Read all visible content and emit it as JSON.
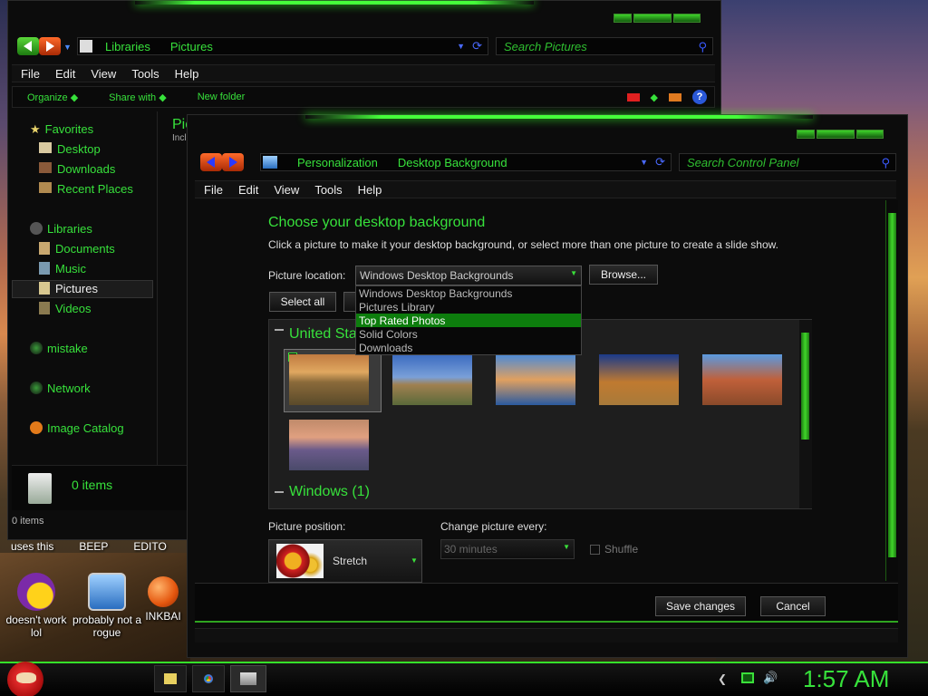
{
  "desktop": {
    "icons": [
      {
        "label": "doesn't work lol",
        "icon": "yahoo-messenger-icon"
      },
      {
        "label": "probably not a rogue",
        "icon": "gears-monitor-icon"
      },
      {
        "label": "INKBAI",
        "icon": "orange-ball-icon"
      }
    ],
    "partial_labels": [
      "uses this",
      "BEEP",
      "EDITO"
    ]
  },
  "explorer": {
    "address": [
      "Libraries",
      "Pictures"
    ],
    "search_placeholder": "Search Pictures",
    "menu": [
      "File",
      "Edit",
      "View",
      "Tools",
      "Help"
    ],
    "toolbar": {
      "organize": "Organize",
      "share": "Share with",
      "new_folder": "New folder"
    },
    "nav": {
      "favorites": "Favorites",
      "favorites_items": [
        "Desktop",
        "Downloads",
        "Recent Places"
      ],
      "libraries": "Libraries",
      "library_items": [
        "Documents",
        "Music",
        "Pictures",
        "Videos"
      ],
      "mistake": "mistake",
      "network": "Network",
      "image_catalog": "Image Catalog"
    },
    "content_title_partial": "Pic",
    "content_sub_partial": "Incl",
    "details_count": "0 items",
    "status": "0 items"
  },
  "personalization": {
    "address": [
      "Personalization",
      "Desktop Background"
    ],
    "search_placeholder": "Search Control Panel",
    "menu": [
      "File",
      "Edit",
      "View",
      "Tools",
      "Help"
    ],
    "heading": "Choose your desktop background",
    "description": "Click a picture to make it your desktop background, or select more than one picture to create a slide show.",
    "location_label": "Picture location:",
    "location_value": "Windows Desktop Backgrounds",
    "browse": "Browse...",
    "select_all": "Select all",
    "dropdown_options": [
      "Windows Desktop Backgrounds",
      "Pictures Library",
      "Top Rated Photos",
      "Solid Colors",
      "Downloads"
    ],
    "dropdown_selected_index": 2,
    "group_us": "United States (6)",
    "group_windows": "Windows (1)",
    "position_label": "Picture position:",
    "position_value": "Stretch",
    "change_label": "Change picture every:",
    "change_value": "30 minutes",
    "shuffle": "Shuffle",
    "save": "Save changes",
    "cancel": "Cancel"
  },
  "taskbar": {
    "clock": "1:57 AM"
  },
  "colors": {
    "accent": "#37e13b",
    "highlight": "#0d7d0d",
    "window_bg": "#0c0c0c"
  }
}
